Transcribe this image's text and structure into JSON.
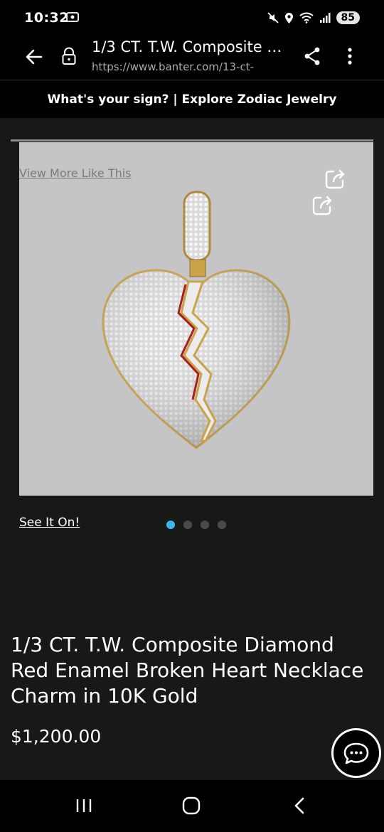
{
  "status_bar": {
    "time": "10:32",
    "battery": "85",
    "icons": [
      "screenshot-icon",
      "mute-icon",
      "location-icon",
      "wifi-icon",
      "signal-icon",
      "battery-icon"
    ]
  },
  "browser": {
    "page_title": "1/3 CT. T.W. Composite Diamond Red Enamel Broken Heart Necklace Charm in 10K Gold",
    "url": "https://www.banter.com/13-ct-",
    "icons": [
      "back-arrow-icon",
      "lock-icon",
      "share-icon",
      "more-vert-icon"
    ]
  },
  "promo": {
    "text": "What's your sign? | Explore Zodiac Jewelry"
  },
  "product": {
    "view_more_label": "View More Like This",
    "see_it_on_label": "See It On!",
    "carousel": {
      "total": 4,
      "active": 0
    },
    "title": "1/3 CT. T.W. Composite Diamond Red Enamel Broken Heart Necklace Charm in 10K Gold",
    "price": "$1,200.00"
  },
  "colors": {
    "accent_dot": "#35b8f0",
    "background": "#181818",
    "image_bg": "#c5c5c7"
  },
  "nav": {
    "icons": [
      "recents-icon",
      "home-icon",
      "nav-back-icon"
    ]
  }
}
